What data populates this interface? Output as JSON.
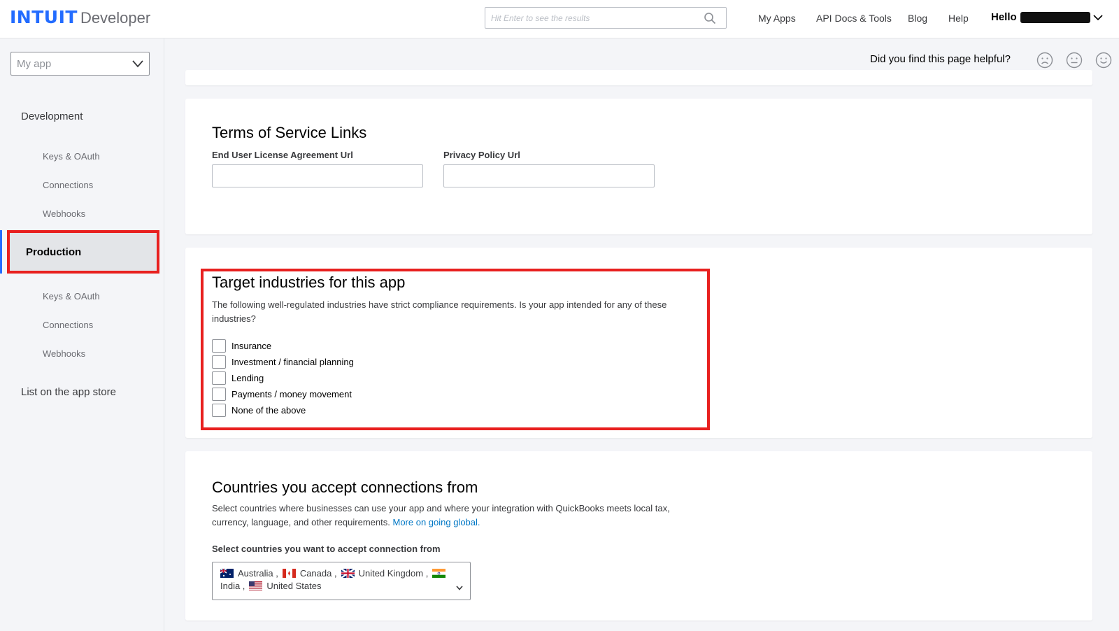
{
  "header": {
    "logo_mark": "INTUIT",
    "logo_text": "Developer",
    "search_placeholder": "Hit Enter to see the results",
    "nav": [
      "My Apps",
      "API Docs & Tools",
      "Blog",
      "Help"
    ],
    "greeting": "Hello"
  },
  "sidebar": {
    "app_select": "My app",
    "development": "Development",
    "dev_items": [
      "Keys & OAuth",
      "Connections",
      "Webhooks"
    ],
    "production": "Production",
    "prod_items": [
      "Keys & OAuth",
      "Connections",
      "Webhooks"
    ],
    "list_store": "List on the app store"
  },
  "feedback": {
    "question": "Did you find this page helpful?"
  },
  "terms": {
    "title": "Terms of Service Links",
    "eula_label": "End User License Agreement Url",
    "eula_value": "",
    "privacy_label": "Privacy Policy Url",
    "privacy_value": ""
  },
  "industries": {
    "title": "Target industries for this app",
    "description": "The following well-regulated industries have strict compliance requirements. Is your app intended for any of these industries?",
    "options": [
      "Insurance",
      "Investment / financial planning",
      "Lending",
      "Payments / money movement",
      "None of the above"
    ]
  },
  "countries": {
    "title": "Countries you accept connections from",
    "description": "Select countries where businesses can use your app and where your integration with QuickBooks meets local tax, currency, language, and other requirements.",
    "link": "More on going global.",
    "select_label": "Select countries you want to accept connection from",
    "selected": [
      "Australia ,",
      "Canada ,",
      "United Kingdom ,",
      "India ,",
      "United States"
    ]
  },
  "colors": {
    "brand_blue": "#236cff",
    "highlight_red": "#e8201f",
    "link_blue": "#0077c5"
  }
}
